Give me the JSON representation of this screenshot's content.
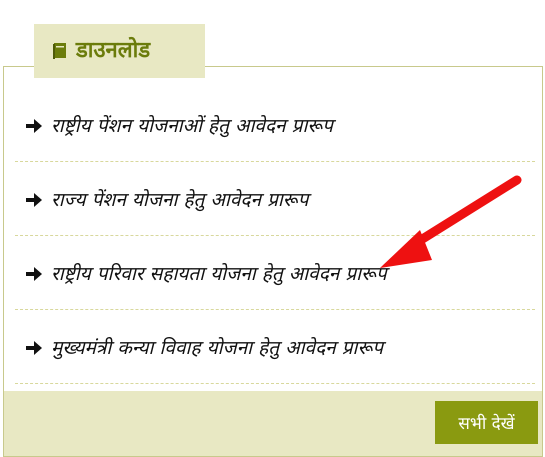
{
  "widget": {
    "title": "डाउनलोड",
    "title_icon": "book-icon",
    "accent_color": "#6b7c0b",
    "tab_bg_color": "#e8e8c3"
  },
  "downloads": {
    "items": [
      {
        "label": "राष्ट्रीय पेंशन योजनाओं हेतु आवेदन प्रारूप",
        "icon": "arrow-right-icon"
      },
      {
        "label": "राज्य पेंशन योजना हेतु आवेदन प्रारूप",
        "icon": "arrow-right-icon"
      },
      {
        "label": "राष्ट्रीय परिवार सहायता योजना हेतु आवेदन प्रारूप",
        "icon": "arrow-right-icon"
      },
      {
        "label": "मुख्यमंत्री कन्या विवाह योजना हेतु आवेदन प्रारूप",
        "icon": "arrow-right-icon"
      }
    ]
  },
  "footer": {
    "view_all_label": "सभी देखें",
    "button_color": "#8a9a10"
  },
  "annotation": {
    "type": "red-arrow",
    "color": "#ee1111",
    "points_to": "राष्ट्रीय परिवार सहायता योजना हेतु आवेदन प्रारूप"
  }
}
